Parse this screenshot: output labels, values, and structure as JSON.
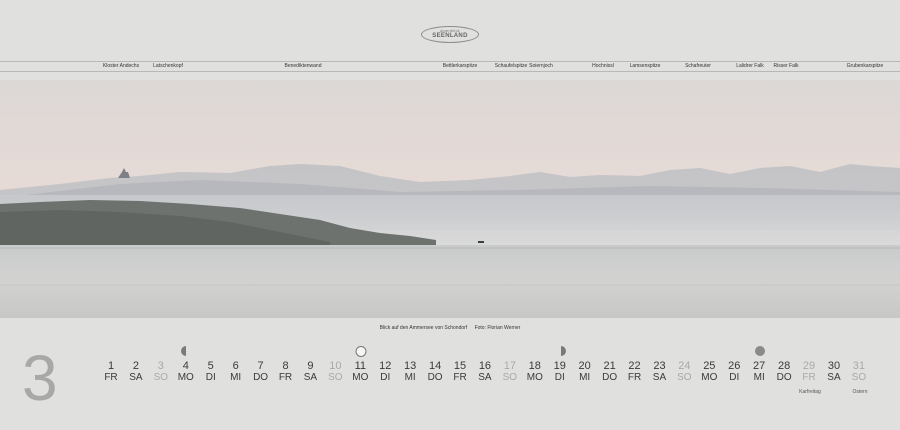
{
  "logo": {
    "line1": "alpenblick",
    "line2": "SEENLAND"
  },
  "peaks": [
    "Kloster Andechs",
    "Latschenkopf",
    "Benediktenwand",
    "Bettlerkarspitze",
    "Schaufelspitze",
    "Soiernjoch",
    "Hochnissl",
    "Lamsenspitze",
    "Schafreuter",
    "Lalidrer Falk",
    "Risser Falk",
    "Grubenkarspitze"
  ],
  "caption": {
    "text": "Blick auf den Ammersee von Schondorf",
    "credit": "Foto: Florian Werner"
  },
  "month_number": "3",
  "days": [
    {
      "n": "1",
      "w": "FR",
      "off": false
    },
    {
      "n": "2",
      "w": "SA",
      "off": false
    },
    {
      "n": "3",
      "w": "SO",
      "off": true
    },
    {
      "n": "4",
      "w": "MO",
      "off": false
    },
    {
      "n": "5",
      "w": "DI",
      "off": false
    },
    {
      "n": "6",
      "w": "MI",
      "off": false
    },
    {
      "n": "7",
      "w": "DO",
      "off": false
    },
    {
      "n": "8",
      "w": "FR",
      "off": false
    },
    {
      "n": "9",
      "w": "SA",
      "off": false
    },
    {
      "n": "10",
      "w": "SO",
      "off": true
    },
    {
      "n": "11",
      "w": "MO",
      "off": false
    },
    {
      "n": "12",
      "w": "DI",
      "off": false
    },
    {
      "n": "13",
      "w": "MI",
      "off": false
    },
    {
      "n": "14",
      "w": "DO",
      "off": false
    },
    {
      "n": "15",
      "w": "FR",
      "off": false
    },
    {
      "n": "16",
      "w": "SA",
      "off": false
    },
    {
      "n": "17",
      "w": "SO",
      "off": true
    },
    {
      "n": "18",
      "w": "MO",
      "off": false
    },
    {
      "n": "19",
      "w": "DI",
      "off": false
    },
    {
      "n": "20",
      "w": "MI",
      "off": false
    },
    {
      "n": "21",
      "w": "DO",
      "off": false
    },
    {
      "n": "22",
      "w": "FR",
      "off": false
    },
    {
      "n": "23",
      "w": "SA",
      "off": false
    },
    {
      "n": "24",
      "w": "SO",
      "off": true
    },
    {
      "n": "25",
      "w": "MO",
      "off": false
    },
    {
      "n": "26",
      "w": "DI",
      "off": false
    },
    {
      "n": "27",
      "w": "MI",
      "off": false
    },
    {
      "n": "28",
      "w": "DO",
      "off": false
    },
    {
      "n": "29",
      "w": "FR",
      "off": true
    },
    {
      "n": "30",
      "w": "SA",
      "off": false
    },
    {
      "n": "31",
      "w": "SO",
      "off": true
    }
  ],
  "holidays": {
    "d29": "Karfreitag",
    "d31": "Ostern"
  },
  "moon_phases": [
    {
      "day": "4",
      "phase": "last-quarter"
    },
    {
      "day": "11",
      "phase": "new-moon"
    },
    {
      "day": "19",
      "phase": "first-quarter"
    },
    {
      "day": "27",
      "phase": "full-moon"
    }
  ]
}
